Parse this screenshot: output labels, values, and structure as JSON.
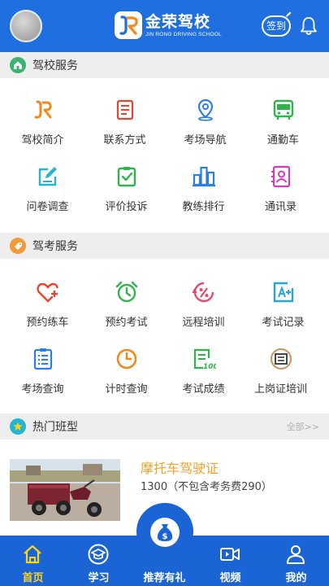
{
  "header": {
    "logo_cn": "金荣驾校",
    "logo_en": "JIN RONG DRIVING SCHOOL",
    "checkin_label": "签到"
  },
  "school_services": {
    "title": "驾校服务",
    "items": [
      {
        "label": "驾校简介",
        "icon": "jr-logo-icon"
      },
      {
        "label": "联系方式",
        "icon": "contact-card-icon"
      },
      {
        "label": "考场导航",
        "icon": "location-pin-icon"
      },
      {
        "label": "通勤车",
        "icon": "bus-icon"
      },
      {
        "label": "问卷调查",
        "icon": "survey-edit-icon"
      },
      {
        "label": "评价投诉",
        "icon": "clipboard-check-icon"
      },
      {
        "label": "教练排行",
        "icon": "bar-ranking-icon"
      },
      {
        "label": "通讯录",
        "icon": "address-book-icon"
      }
    ]
  },
  "exam_services": {
    "title": "驾考服务",
    "items": [
      {
        "label": "预约练车",
        "icon": "heart-plus-icon"
      },
      {
        "label": "预约考试",
        "icon": "alarm-clock-icon"
      },
      {
        "label": "远程培训",
        "icon": "percent-circle-icon"
      },
      {
        "label": "考试记录",
        "icon": "grade-a-plus-icon"
      },
      {
        "label": "考场查询",
        "icon": "list-check-icon"
      },
      {
        "label": "计时查询",
        "icon": "clock-icon"
      },
      {
        "label": "考试成绩",
        "icon": "score-100-icon"
      },
      {
        "label": "上岗证培训",
        "icon": "certificate-icon"
      }
    ]
  },
  "hot_courses": {
    "title": "热门班型",
    "more_label": "全部>>",
    "items": [
      {
        "title": "摩托车驾驶证",
        "price": "1300（不包含考务费290）"
      }
    ]
  },
  "nav": {
    "items": [
      {
        "label": "首页",
        "icon": "home-icon",
        "active": true
      },
      {
        "label": "学习",
        "icon": "graduation-cap-icon",
        "active": false
      },
      {
        "label": "推荐有礼",
        "icon": "money-bag-icon",
        "active": false
      },
      {
        "label": "视频",
        "icon": "video-icon",
        "active": false
      },
      {
        "label": "我的",
        "icon": "user-icon",
        "active": false
      }
    ]
  },
  "colors": {
    "brand_blue": "#1f6fe0",
    "nav_blue": "#1a64d6",
    "active_yellow": "#ffd21a",
    "course_title_orange": "#f2a22b"
  }
}
